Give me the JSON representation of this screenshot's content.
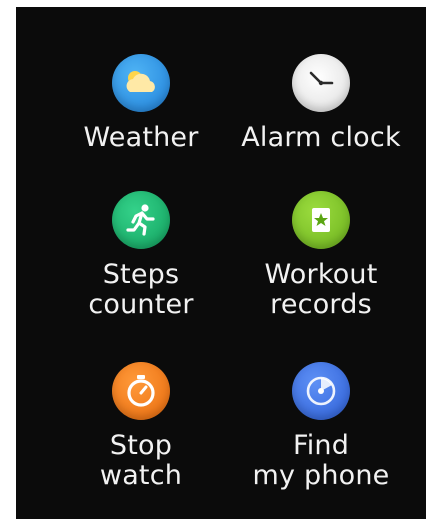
{
  "apps": [
    {
      "label": "Weather",
      "icon": "weather-icon",
      "color": "#2a8fe0"
    },
    {
      "label": "Alarm clock",
      "icon": "clock-icon",
      "color": "#f4f4f4"
    },
    {
      "label": "Steps\ncounter",
      "icon": "runner-icon",
      "color": "#18b26b"
    },
    {
      "label": "Workout\nrecords",
      "icon": "records-icon",
      "color": "#7fc62a"
    },
    {
      "label": "Stop\nwatch",
      "icon": "stopwatch-icon",
      "color": "#f07a18"
    },
    {
      "label": "Find\nmy phone",
      "icon": "find-phone-icon",
      "color": "#3f73e6"
    }
  ]
}
